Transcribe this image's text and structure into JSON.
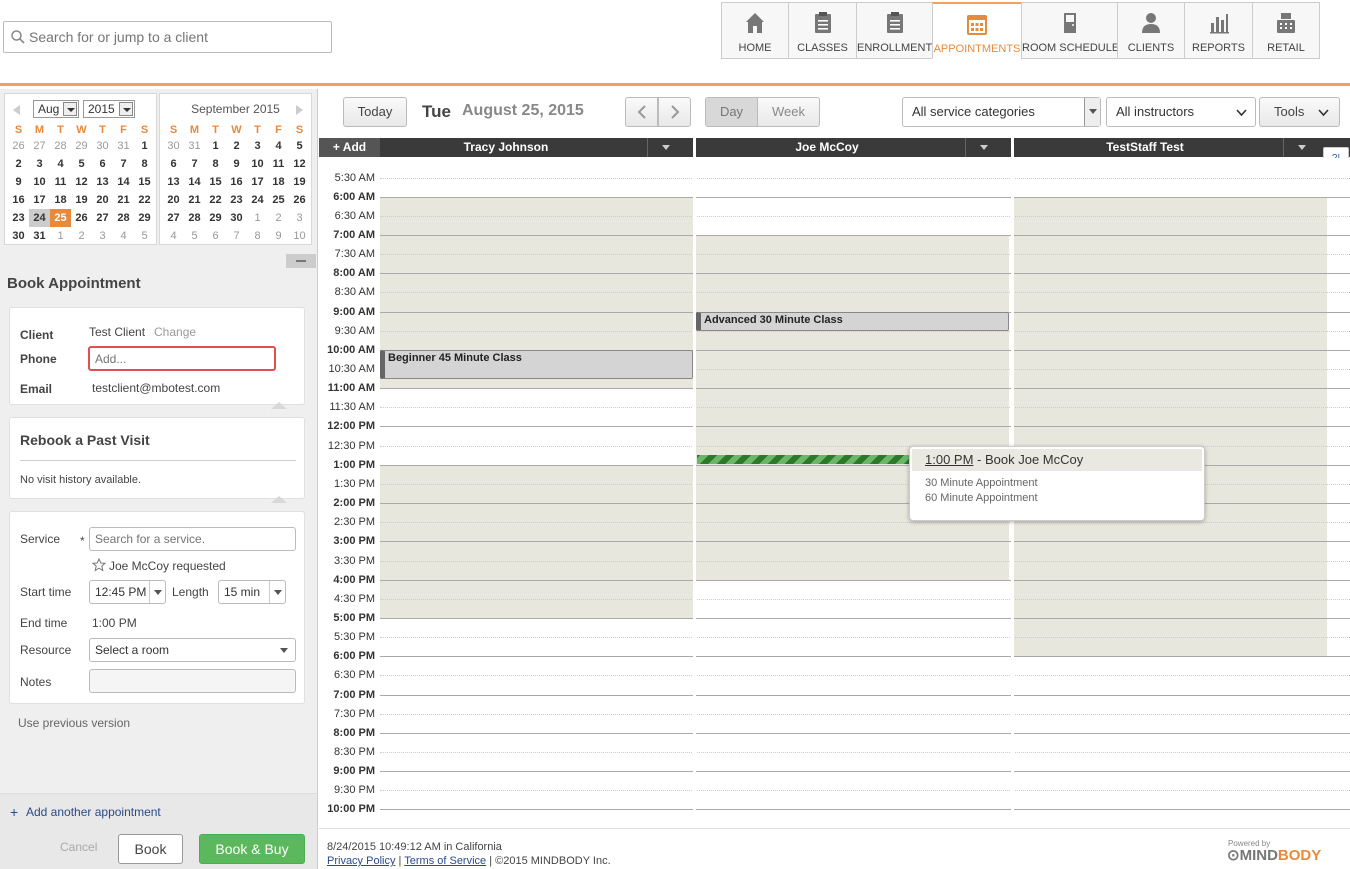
{
  "search": {
    "placeholder": "Search for or jump to a client"
  },
  "nav": [
    {
      "label": "HOME",
      "icon": "home-icon"
    },
    {
      "label": "CLASSES",
      "icon": "clipboard-icon"
    },
    {
      "label": "ENROLLMENTS",
      "icon": "clipboard-icon"
    },
    {
      "label": "APPOINTMENTS",
      "icon": "calendar-icon",
      "active": true
    },
    {
      "label": "ROOM SCHEDULE",
      "icon": "door-icon"
    },
    {
      "label": "CLIENTS",
      "icon": "person-icon"
    },
    {
      "label": "REPORTS",
      "icon": "bar-chart-icon"
    },
    {
      "label": "RETAIL",
      "icon": "register-icon"
    }
  ],
  "colors": {
    "accent": "#e88a3c",
    "book_buy": "#5cb85c",
    "availability": "#e7e7dd"
  },
  "mini_cal": {
    "left": {
      "month": "Aug",
      "year": "2015",
      "weekdays": [
        "S",
        "M",
        "T",
        "W",
        "T",
        "F",
        "S"
      ],
      "weeks": [
        [
          {
            "d": "26",
            "o": true
          },
          {
            "d": "27",
            "o": true
          },
          {
            "d": "28",
            "o": true
          },
          {
            "d": "29",
            "o": true
          },
          {
            "d": "30",
            "o": true
          },
          {
            "d": "31",
            "o": true
          },
          {
            "d": "1"
          }
        ],
        [
          {
            "d": "2"
          },
          {
            "d": "3"
          },
          {
            "d": "4"
          },
          {
            "d": "5"
          },
          {
            "d": "6"
          },
          {
            "d": "7"
          },
          {
            "d": "8"
          }
        ],
        [
          {
            "d": "9"
          },
          {
            "d": "10"
          },
          {
            "d": "11"
          },
          {
            "d": "12"
          },
          {
            "d": "13"
          },
          {
            "d": "14"
          },
          {
            "d": "15"
          }
        ],
        [
          {
            "d": "16"
          },
          {
            "d": "17"
          },
          {
            "d": "18"
          },
          {
            "d": "19"
          },
          {
            "d": "20"
          },
          {
            "d": "21"
          },
          {
            "d": "22"
          }
        ],
        [
          {
            "d": "23"
          },
          {
            "d": "24",
            "today": true
          },
          {
            "d": "25",
            "sel": true
          },
          {
            "d": "26"
          },
          {
            "d": "27"
          },
          {
            "d": "28"
          },
          {
            "d": "29"
          }
        ],
        [
          {
            "d": "30"
          },
          {
            "d": "31"
          },
          {
            "d": "1",
            "o": true
          },
          {
            "d": "2",
            "o": true
          },
          {
            "d": "3",
            "o": true
          },
          {
            "d": "4",
            "o": true
          },
          {
            "d": "5",
            "o": true
          }
        ]
      ]
    },
    "right": {
      "title": "September 2015",
      "weekdays": [
        "S",
        "M",
        "T",
        "W",
        "T",
        "F",
        "S"
      ],
      "weeks": [
        [
          {
            "d": "30",
            "o": true
          },
          {
            "d": "31",
            "o": true
          },
          {
            "d": "1"
          },
          {
            "d": "2"
          },
          {
            "d": "3"
          },
          {
            "d": "4"
          },
          {
            "d": "5"
          }
        ],
        [
          {
            "d": "6"
          },
          {
            "d": "7"
          },
          {
            "d": "8"
          },
          {
            "d": "9"
          },
          {
            "d": "10"
          },
          {
            "d": "11"
          },
          {
            "d": "12"
          }
        ],
        [
          {
            "d": "13"
          },
          {
            "d": "14"
          },
          {
            "d": "15"
          },
          {
            "d": "16"
          },
          {
            "d": "17"
          },
          {
            "d": "18"
          },
          {
            "d": "19"
          }
        ],
        [
          {
            "d": "20"
          },
          {
            "d": "21"
          },
          {
            "d": "22"
          },
          {
            "d": "23"
          },
          {
            "d": "24"
          },
          {
            "d": "25"
          },
          {
            "d": "26"
          }
        ],
        [
          {
            "d": "27"
          },
          {
            "d": "28"
          },
          {
            "d": "29"
          },
          {
            "d": "30"
          },
          {
            "d": "1",
            "o": true
          },
          {
            "d": "2",
            "o": true
          },
          {
            "d": "3",
            "o": true
          }
        ],
        [
          {
            "d": "4",
            "o": true
          },
          {
            "d": "5",
            "o": true
          },
          {
            "d": "6",
            "o": true
          },
          {
            "d": "7",
            "o": true
          },
          {
            "d": "8",
            "o": true
          },
          {
            "d": "9",
            "o": true
          },
          {
            "d": "10",
            "o": true
          }
        ]
      ]
    }
  },
  "book": {
    "heading": "Book Appointment",
    "client_label": "Client",
    "client_value": "Test Client",
    "change_label": "Change",
    "phone_label": "Phone",
    "phone_placeholder": "Add...",
    "email_label": "Email",
    "email_value": "testclient@mbotest.com",
    "rebook_heading": "Rebook a Past Visit",
    "rebook_empty": "No visit history available.",
    "service_label": "Service",
    "required_mark": "*",
    "service_placeholder": "Search for a service.",
    "requested_text": "Joe McCoy requested",
    "start_label": "Start time",
    "start_value": "12:45 PM",
    "length_label": "Length",
    "length_value": "15 min",
    "end_label": "End time",
    "end_value": "1:00 PM",
    "resource_label": "Resource",
    "resource_value": "Select a room",
    "notes_label": "Notes",
    "prev_version": "Use previous version",
    "add_another": "Add another appointment",
    "cancel": "Cancel",
    "book": "Book",
    "book_buy": "Book & Buy"
  },
  "toolbar": {
    "today": "Today",
    "day_name": "Tue",
    "date": "August 25, 2015",
    "day": "Day",
    "week": "Week",
    "categories": "All service categories",
    "instructors": "All instructors",
    "tools": "Tools",
    "add": "+ Add",
    "help": "?!"
  },
  "columns": [
    "Tracy Johnson",
    "Joe McCoy",
    "TestStaff Test"
  ],
  "times": [
    "5:30 AM",
    "6:00 AM",
    "6:30 AM",
    "7:00 AM",
    "7:30 AM",
    "8:00 AM",
    "8:30 AM",
    "9:00 AM",
    "9:30 AM",
    "10:00 AM",
    "10:30 AM",
    "11:00 AM",
    "11:30 AM",
    "12:00 PM",
    "12:30 PM",
    "1:00 PM",
    "1:30 PM",
    "2:00 PM",
    "2:30 PM",
    "3:00 PM",
    "3:30 PM",
    "4:00 PM",
    "4:30 PM",
    "5:00 PM",
    "5:30 PM",
    "6:00 PM",
    "6:30 PM",
    "7:00 PM",
    "7:30 PM",
    "8:00 PM",
    "8:30 PM",
    "9:00 PM",
    "9:30 PM",
    "10:00 PM"
  ],
  "appointments": [
    {
      "title": "Beginner 45 Minute Class",
      "column": "Tracy Johnson",
      "start": "10:00 AM"
    },
    {
      "title": "Advanced 30 Minute Class",
      "column": "Joe McCoy",
      "start": "9:00 AM"
    }
  ],
  "availability": [
    {
      "column": "Tracy Johnson",
      "ranges": [
        [
          "6:00 AM",
          "11:00 AM"
        ],
        [
          "1:00 PM",
          "5:00 PM"
        ]
      ]
    },
    {
      "column": "Joe McCoy",
      "ranges": [
        [
          "7:00 AM",
          "4:00 PM"
        ]
      ]
    },
    {
      "column": "TestStaff Test",
      "ranges": [
        [
          "6:00 AM",
          "6:00 PM"
        ]
      ]
    }
  ],
  "popup": {
    "time": "1:00 PM",
    "title": " - Book Joe McCoy",
    "options": [
      "30 Minute Appointment",
      "60 Minute Appointment"
    ]
  },
  "footer": {
    "timestamp": "8/24/2015 10:49:12 AM in California",
    "privacy": "Privacy Policy",
    "sep1": " | ",
    "terms": "Terms of Service",
    "copyright": " | ©2015 MINDBODY Inc.",
    "powered": "Powered by",
    "brand1": "MIND",
    "brand2": "BODY",
    "brand0": "⊙"
  }
}
